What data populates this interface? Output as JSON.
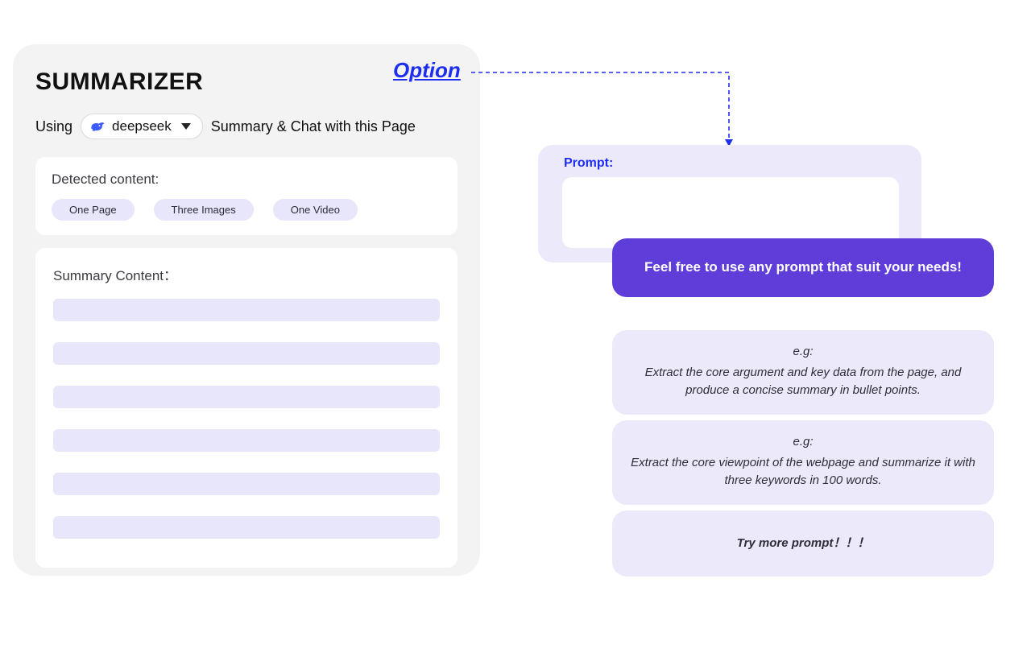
{
  "panel": {
    "title": "SUMMARIZER",
    "using_label": "Using",
    "model_name": "deepseek",
    "subtitle": "Summary & Chat with this Page"
  },
  "detected": {
    "label": "Detected content:",
    "chips": [
      "One Page",
      "Three Images",
      "One Video"
    ]
  },
  "summary": {
    "label": "Summary Content："
  },
  "callout": {
    "option_label": "Option"
  },
  "prompt": {
    "title": "Prompt:",
    "value": ""
  },
  "banner": {
    "text": "Feel free to use any prompt that suit your needs!"
  },
  "examples": [
    {
      "eg": "e.g:",
      "body": "Extract the core argument and key data from the page, and produce a concise summary in bullet points."
    },
    {
      "eg": "e.g:",
      "body": "Extract the core viewpoint of the webpage and summarize it with three keywords in 100 words."
    },
    {
      "eg": "",
      "body": "Try more prompt！！！"
    }
  ]
}
